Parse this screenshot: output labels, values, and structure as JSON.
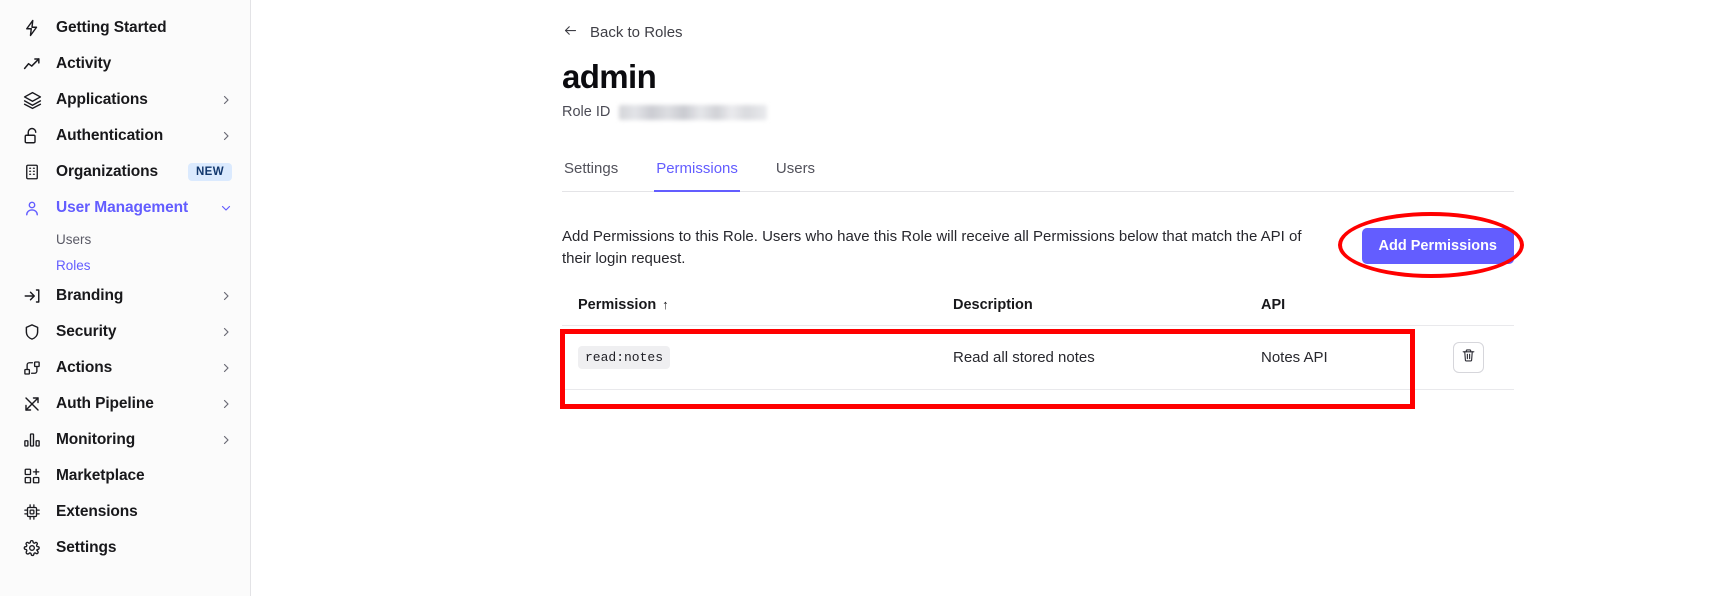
{
  "sidebar": {
    "items": [
      {
        "label": "Getting Started",
        "icon": "bolt-icon",
        "chevron": false,
        "badge": null,
        "active": false
      },
      {
        "label": "Activity",
        "icon": "trend-up-icon",
        "chevron": false,
        "badge": null,
        "active": false
      },
      {
        "label": "Applications",
        "icon": "layers-icon",
        "chevron": true,
        "badge": null,
        "active": false
      },
      {
        "label": "Authentication",
        "icon": "lock-open-icon",
        "chevron": true,
        "badge": null,
        "active": false
      },
      {
        "label": "Organizations",
        "icon": "building-icon",
        "chevron": false,
        "badge": "NEW",
        "active": false
      },
      {
        "label": "User Management",
        "icon": "user-icon",
        "chevron": true,
        "badge": null,
        "active": true
      },
      {
        "label": "Branding",
        "icon": "login-arrow-icon",
        "chevron": true,
        "badge": null,
        "active": false
      },
      {
        "label": "Security",
        "icon": "shield-icon",
        "chevron": true,
        "badge": null,
        "active": false
      },
      {
        "label": "Actions",
        "icon": "actions-icon",
        "chevron": true,
        "badge": null,
        "active": false
      },
      {
        "label": "Auth Pipeline",
        "icon": "shuffle-icon",
        "chevron": true,
        "badge": null,
        "active": false
      },
      {
        "label": "Monitoring",
        "icon": "bar-chart-icon",
        "chevron": true,
        "badge": null,
        "active": false
      },
      {
        "label": "Marketplace",
        "icon": "grid-plus-icon",
        "chevron": false,
        "badge": null,
        "active": false
      },
      {
        "label": "Extensions",
        "icon": "chip-icon",
        "chevron": false,
        "badge": null,
        "active": false
      },
      {
        "label": "Settings",
        "icon": "gear-icon",
        "chevron": false,
        "badge": null,
        "active": false
      }
    ],
    "subitems": [
      {
        "label": "Users",
        "active": false
      },
      {
        "label": "Roles",
        "active": true
      }
    ]
  },
  "header": {
    "back_label": "Back to Roles",
    "back_icon": "arrow-left-icon",
    "title": "admin",
    "role_id_label": "Role ID",
    "role_id_value": ""
  },
  "tabs": [
    {
      "label": "Settings",
      "active": false
    },
    {
      "label": "Permissions",
      "active": true
    },
    {
      "label": "Users",
      "active": false
    }
  ],
  "panel": {
    "description": "Add Permissions to this Role. Users who have this Role will receive all Permissions below that match the API of their login request.",
    "add_button_label": "Add Permissions"
  },
  "table": {
    "columns": [
      {
        "label": "Permission",
        "sort": "↑"
      },
      {
        "label": "Description",
        "sort": ""
      },
      {
        "label": "API",
        "sort": ""
      }
    ],
    "rows": [
      {
        "permission": "read:notes",
        "description": "Read all stored notes",
        "api": "Notes API",
        "delete_icon": "trash-icon"
      }
    ]
  },
  "colors": {
    "accent": "#635dff",
    "highlight": "#ff0000",
    "badge_bg": "#dbeafe",
    "badge_fg": "#12386e"
  }
}
